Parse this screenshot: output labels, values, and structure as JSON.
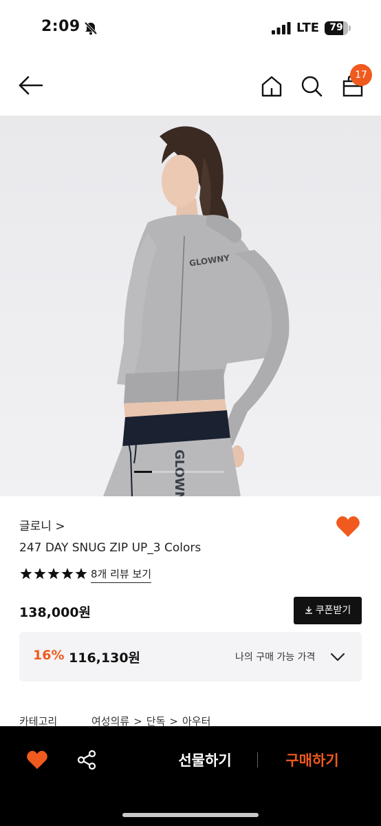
{
  "status_bar": {
    "time": "2:09",
    "network": "LTE",
    "battery": "79",
    "battery_level": 0.79
  },
  "nav": {
    "cart_count": "17",
    "icons": [
      "back-arrow-icon",
      "home-icon",
      "search-icon",
      "shopping-bag-icon"
    ]
  },
  "product": {
    "brand": "글로니 >",
    "title": "247 DAY SNUG ZIP UP_3 Colors",
    "rating_stars": 5,
    "review_link": "8개 리뷰 보기",
    "price": "138,000원",
    "coupon_button": "쿠폰받기",
    "discount_rate": "16%",
    "discount_price": "116,130원",
    "discount_label": "나의 구매 가능 가격",
    "category_label": "카테고리",
    "category_path": [
      "여성의류",
      "단독",
      "아우터"
    ],
    "image_print": "GLOWNY"
  },
  "bottom_bar": {
    "gift_button": "선물하기",
    "buy_button": "구매하기"
  },
  "colors": {
    "accent": "#f05a1e",
    "dark": "#111111",
    "panel": "#f4f4f6"
  }
}
